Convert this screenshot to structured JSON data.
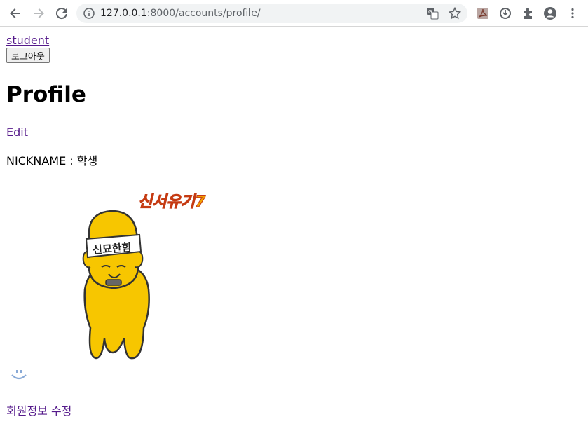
{
  "browser": {
    "url_host": "127.0.0.1",
    "url_path": ":8000/accounts/profile/"
  },
  "header": {
    "username": "student",
    "logout_label": "로그아웃"
  },
  "main": {
    "title": "Profile",
    "edit_label": "Edit",
    "nickname_label": "NICKNAME",
    "nickname_sep": " : ",
    "nickname_value": "학생",
    "image_caption_top": "신서유기7",
    "image_headband": "신묘한힘",
    "member_edit_label": "회원정보 수정"
  },
  "colors": {
    "accent": "#f7c600",
    "link": "#551a8b"
  }
}
